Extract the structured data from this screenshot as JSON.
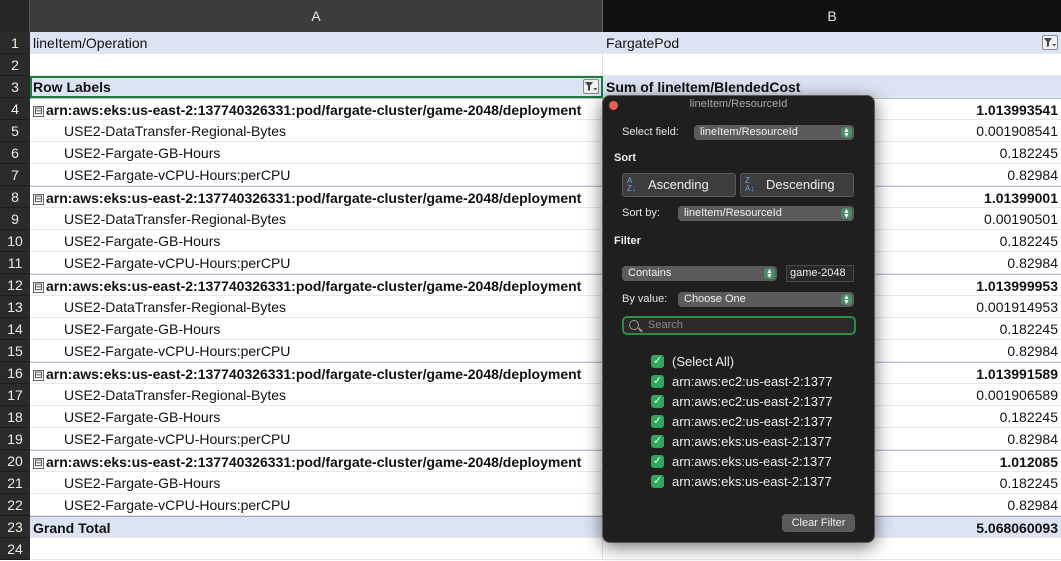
{
  "sheet": {
    "columns": [
      {
        "label": "A"
      },
      {
        "label": "B"
      }
    ],
    "rows": [
      {
        "num": "1",
        "a": "lineItem/Operation",
        "b": "FargatePod"
      },
      {
        "num": "2",
        "a": "",
        "b": ""
      },
      {
        "num": "3",
        "a": "Row Labels",
        "b": "Sum of lineItem/BlendedCost"
      },
      {
        "num": "4",
        "a": "arn:aws:eks:us-east-2:137740326331:pod/fargate-cluster/game-2048/deployment",
        "b": "1.013993541"
      },
      {
        "num": "5",
        "a": "USE2-DataTransfer-Regional-Bytes",
        "b": "0.001908541"
      },
      {
        "num": "6",
        "a": "USE2-Fargate-GB-Hours",
        "b": "0.182245"
      },
      {
        "num": "7",
        "a": "USE2-Fargate-vCPU-Hours:perCPU",
        "b": "0.82984"
      },
      {
        "num": "8",
        "a": "arn:aws:eks:us-east-2:137740326331:pod/fargate-cluster/game-2048/deployment",
        "b": "1.01399001"
      },
      {
        "num": "9",
        "a": "USE2-DataTransfer-Regional-Bytes",
        "b": "0.00190501"
      },
      {
        "num": "10",
        "a": "USE2-Fargate-GB-Hours",
        "b": "0.182245"
      },
      {
        "num": "11",
        "a": "USE2-Fargate-vCPU-Hours:perCPU",
        "b": "0.82984"
      },
      {
        "num": "12",
        "a": "arn:aws:eks:us-east-2:137740326331:pod/fargate-cluster/game-2048/deployment",
        "b": "1.013999953"
      },
      {
        "num": "13",
        "a": "USE2-DataTransfer-Regional-Bytes",
        "b": "0.001914953"
      },
      {
        "num": "14",
        "a": "USE2-Fargate-GB-Hours",
        "b": "0.182245"
      },
      {
        "num": "15",
        "a": "USE2-Fargate-vCPU-Hours:perCPU",
        "b": "0.82984"
      },
      {
        "num": "16",
        "a": "arn:aws:eks:us-east-2:137740326331:pod/fargate-cluster/game-2048/deployment",
        "b": "1.013991589"
      },
      {
        "num": "17",
        "a": "USE2-DataTransfer-Regional-Bytes",
        "b": "0.001906589"
      },
      {
        "num": "18",
        "a": "USE2-Fargate-GB-Hours",
        "b": "0.182245"
      },
      {
        "num": "19",
        "a": "USE2-Fargate-vCPU-Hours:perCPU",
        "b": "0.82984"
      },
      {
        "num": "20",
        "a": "arn:aws:eks:us-east-2:137740326331:pod/fargate-cluster/game-2048/deployment",
        "b": "1.012085"
      },
      {
        "num": "21",
        "a": "USE2-Fargate-GB-Hours",
        "b": "0.182245"
      },
      {
        "num": "22",
        "a": "USE2-Fargate-vCPU-Hours:perCPU",
        "b": "0.82984"
      },
      {
        "num": "23",
        "a": "Grand Total",
        "b": "5.068060093"
      },
      {
        "num": "24",
        "a": "",
        "b": ""
      }
    ],
    "collapse_glyph": "⊟"
  },
  "popup": {
    "title": "lineItem/ResourceId",
    "select_field_label": "Select field:",
    "select_field_value": "lineItem/ResourceId",
    "sort_heading": "Sort",
    "ascending_label": "Ascending",
    "descending_label": "Descending",
    "sort_by_label": "Sort by:",
    "sort_by_value": "lineItem/ResourceId",
    "filter_heading": "Filter",
    "condition_value": "Contains",
    "condition_text": "game-2048",
    "by_value_label": "By value:",
    "by_value_value": "Choose One",
    "search_placeholder": "Search",
    "items": [
      {
        "label": "(Select All)",
        "checked": true
      },
      {
        "label": "arn:aws:ec2:us-east-2:1377",
        "checked": true
      },
      {
        "label": "arn:aws:ec2:us-east-2:1377",
        "checked": true
      },
      {
        "label": "arn:aws:ec2:us-east-2:1377",
        "checked": true
      },
      {
        "label": "arn:aws:eks:us-east-2:1377",
        "checked": true
      },
      {
        "label": "arn:aws:eks:us-east-2:1377",
        "checked": true
      },
      {
        "label": "arn:aws:eks:us-east-2:1377",
        "checked": true
      }
    ],
    "clear_filter_label": "Clear Filter"
  },
  "colors": {
    "accent_green": "#2fa75d",
    "pivot_header": "#dce3f3"
  }
}
